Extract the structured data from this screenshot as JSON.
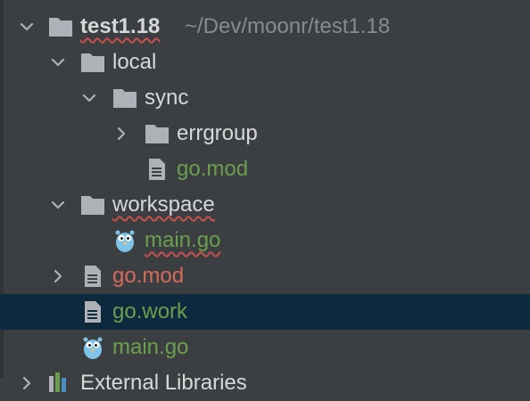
{
  "colors": {
    "background": "#3c3f41",
    "selection": "#0d293e",
    "folder": "#aeb2b6",
    "text": "#d6d8da",
    "modified_green": "#6a9f4f",
    "error_red": "#d46a5a",
    "path_gray": "#888c8f"
  },
  "tree": {
    "root": {
      "name": "test1.18",
      "path": "~/Dev/moonr/test1.18"
    },
    "local": {
      "name": "local"
    },
    "sync": {
      "name": "sync"
    },
    "errgroup": {
      "name": "errgroup"
    },
    "sync_gomod": {
      "name": "go.mod"
    },
    "workspace": {
      "name": "workspace"
    },
    "workspace_main": {
      "name": "main.go"
    },
    "root_gomod": {
      "name": "go.mod"
    },
    "root_gowork": {
      "name": "go.work"
    },
    "root_main": {
      "name": "main.go"
    },
    "external": {
      "name": "External Libraries"
    }
  },
  "icons": {
    "expanded": "chevron-down-icon",
    "collapsed": "chevron-right-icon",
    "folder": "folder-icon",
    "file": "file-icon",
    "gopher": "gopher-icon",
    "library": "library-icon"
  }
}
